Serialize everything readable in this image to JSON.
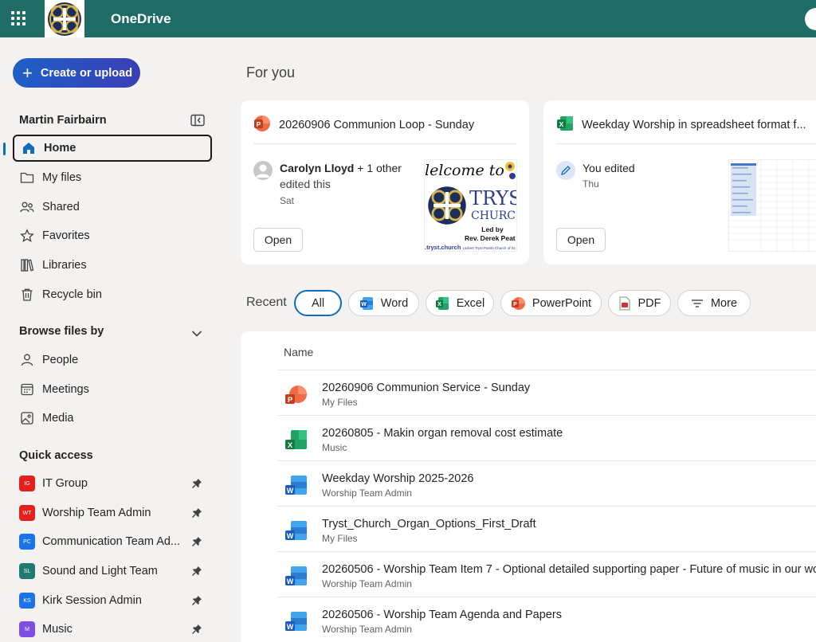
{
  "app": {
    "title": "OneDrive"
  },
  "sidebar": {
    "create_label": "Create or upload",
    "user_name": "Martin Fairbairn",
    "nav": [
      {
        "label": "Home",
        "icon": "home-icon"
      },
      {
        "label": "My files",
        "icon": "folder-icon"
      },
      {
        "label": "Shared",
        "icon": "people-icon"
      },
      {
        "label": "Favorites",
        "icon": "star-icon"
      },
      {
        "label": "Libraries",
        "icon": "library-icon"
      },
      {
        "label": "Recycle bin",
        "icon": "trash-icon"
      }
    ],
    "browse_heading": "Browse files by",
    "browse": [
      {
        "label": "People",
        "icon": "person-icon"
      },
      {
        "label": "Meetings",
        "icon": "calendar-icon"
      },
      {
        "label": "Media",
        "icon": "image-icon"
      }
    ],
    "quick_heading": "Quick access",
    "quick": [
      {
        "label": "IT Group",
        "initials": "IG",
        "color": "#e3201b"
      },
      {
        "label": "Worship Team Admin",
        "initials": "WT",
        "color": "#e3201b"
      },
      {
        "label": "Communication Team Ad...",
        "initials": "PC",
        "color": "#1a73e8"
      },
      {
        "label": "Sound and Light Team",
        "initials": "SL",
        "color": "#1f7a72"
      },
      {
        "label": "Kirk Session Admin",
        "initials": "KS",
        "color": "#1a73e8"
      },
      {
        "label": "Music",
        "initials": "M",
        "color": "#7b4fe0"
      }
    ]
  },
  "main": {
    "for_you": "For you",
    "cards": [
      {
        "title": "20260906 Communion Loop - Sunday",
        "file_type": "powerpoint",
        "person": "Carolyn Lloyd",
        "person_suffix": " + 1 other",
        "action": "edited this",
        "when": "Sat",
        "open_label": "Open",
        "thumb": {
          "welcome": "lelcome to",
          "tryst": "TRYST",
          "church": "CHURC",
          "led_by": "Led by",
          "minister": "Rev. Derek Peat",
          "footer": ".tryst.church",
          "footer_small": "Larbert Tryst Parish Church of Sc"
        }
      },
      {
        "title": "Weekday Worship in spreadsheet format f...",
        "file_type": "excel",
        "action": "You edited",
        "when": "Thu",
        "open_label": "Open"
      }
    ],
    "recent_label": "Recent",
    "filters": [
      {
        "label": "All",
        "icon": ""
      },
      {
        "label": "Word",
        "icon": "word-icon"
      },
      {
        "label": "Excel",
        "icon": "excel-icon"
      },
      {
        "label": "PowerPoint",
        "icon": "powerpoint-icon"
      },
      {
        "label": "PDF",
        "icon": "pdf-icon"
      },
      {
        "label": "More",
        "icon": "filter-lines-icon"
      }
    ],
    "list": {
      "column_name": "Name",
      "rows": [
        {
          "name": "20260906 Communion Service - Sunday",
          "location": "My Files",
          "type": "powerpoint"
        },
        {
          "name": "20260805 - Makin organ removal cost estimate",
          "location": "Music",
          "type": "excel"
        },
        {
          "name": "Weekday Worship 2025-2026",
          "location": "Worship Team Admin",
          "type": "word"
        },
        {
          "name": "Tryst_Church_Organ_Options_First_Draft",
          "location": "My Files",
          "type": "word"
        },
        {
          "name": "20260506 - Worship Team Item 7 - Optional detailed supporting paper - Future of music in our wo",
          "location": "Worship Team Admin",
          "type": "word"
        },
        {
          "name": "20260506 - Worship Team Agenda and Papers",
          "location": "Worship Team Admin",
          "type": "word"
        }
      ]
    }
  },
  "colors": {
    "topbar": "#1f6b65",
    "accent": "#0f6cbd",
    "word": "#185abd",
    "excel": "#107c41",
    "powerpoint": "#c43e1c"
  }
}
